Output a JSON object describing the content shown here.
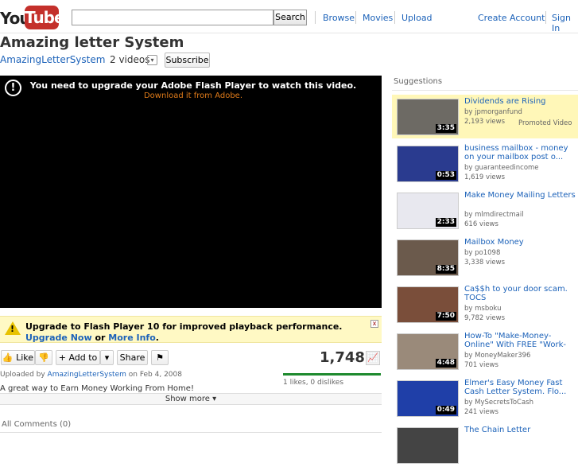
{
  "header": {
    "logo_you": "You",
    "logo_tube": "Tube",
    "search_value": "",
    "search_button": "Search",
    "nav": [
      "Browse",
      "Movies",
      "Upload"
    ],
    "account": [
      "Create Account",
      "Sign In"
    ]
  },
  "video": {
    "title": "Amazing letter System",
    "channel": "AmazingLetterSystem",
    "videos_count": "2 videos",
    "subscribe": "Subscribe",
    "player_message": "You need to upgrade your Adobe Flash Player to watch this video.",
    "player_link": "Download it from Adobe.",
    "warn_icon": "!"
  },
  "upgrade_bar": {
    "text_part1": "Upgrade to Flash Player 10 for improved playback performance. ",
    "link1": "Upgrade Now",
    "text_part2": " or ",
    "link2": "More Info",
    "text_part3": ".",
    "close": "x"
  },
  "actions": {
    "like": "Like",
    "add_to": "Add to",
    "share": "Share",
    "views": "1,748",
    "likes_summary": "1 likes, 0 dislikes",
    "like_ratio": 1.0
  },
  "details": {
    "uploaded_prefix": "Uploaded by ",
    "uploader": "AmazingLetterSystem",
    "uploaded_date": " on Feb 4, 2008",
    "description": "A great way to Earn Money Working From Home!",
    "show_more": "Show more ▾",
    "comments": "All Comments (0)"
  },
  "suggestions": {
    "heading": "Suggestions",
    "items": [
      {
        "title": "Dividends are Rising",
        "by": "by jpmorganfund",
        "views": "2,193 views",
        "duration": "3:35",
        "promoted": "Promoted Video",
        "thumb": "#6d6a64"
      },
      {
        "title": "business mailbox - money on your mailbox post o...",
        "by": "by guaranteedincome",
        "views": "1,619 views",
        "duration": "0:53",
        "promoted": "",
        "thumb": "#2a3b8f"
      },
      {
        "title": "Make Money Mailing Letters",
        "by": "by mlmdirectmail",
        "views": "616 views",
        "duration": "2:33",
        "promoted": "",
        "thumb": "#e8e8ef"
      },
      {
        "title": "Mailbox Money",
        "by": "by po1098",
        "views": "3,338 views",
        "duration": "8:35",
        "promoted": "",
        "thumb": "#6b5a4c"
      },
      {
        "title": "Ca$$h to your door scam. TOCS",
        "by": "by msboku",
        "views": "9,782 views",
        "duration": "7:50",
        "promoted": "",
        "thumb": "#7a4e3a"
      },
      {
        "title": "How-To \"Make-Money-Online\" With FREE \"Work-At-...",
        "by": "by MoneyMaker396",
        "views": "701 views",
        "duration": "4:48",
        "promoted": "",
        "thumb": "#9a8a7a"
      },
      {
        "title": "Elmer's Easy Money Fast Cash Letter System. Flo...",
        "by": "by MySecretsToCash",
        "views": "241 views",
        "duration": "0:49",
        "promoted": "",
        "thumb": "#1f3fa8"
      },
      {
        "title": "The Chain Letter",
        "by": "",
        "views": "",
        "duration": "",
        "promoted": "",
        "thumb": "#444"
      }
    ]
  }
}
